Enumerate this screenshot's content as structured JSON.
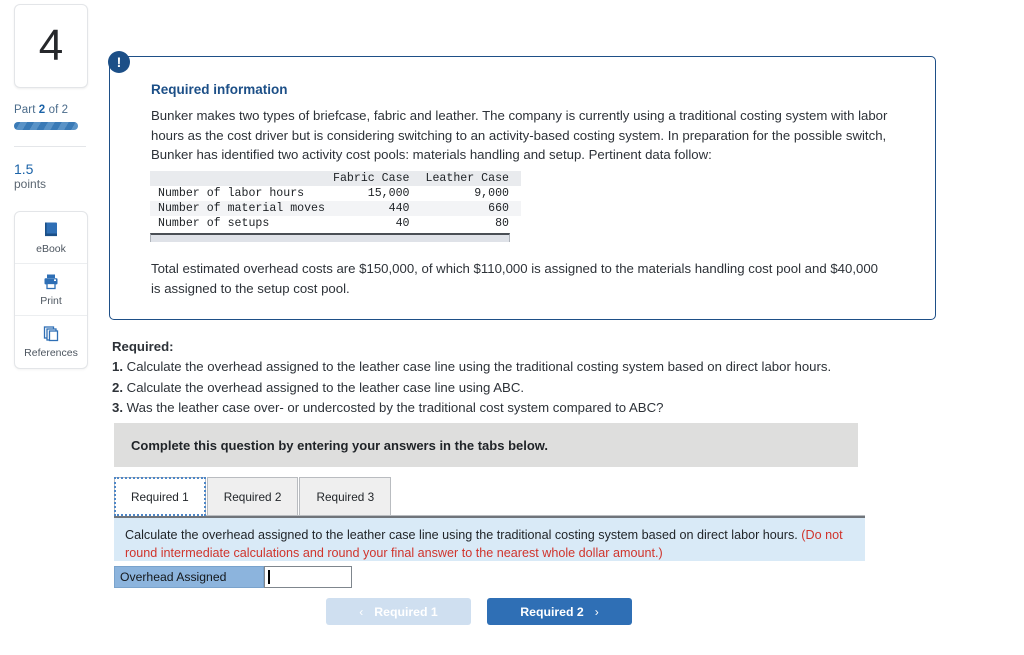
{
  "sidebar": {
    "question_number": "4",
    "part_label_prefix": "Part ",
    "part_current": "2",
    "part_suffix": " of 2",
    "points_value": "1.5",
    "points_label": "points",
    "tools": [
      {
        "label": "eBook",
        "icon": "ebook-icon"
      },
      {
        "label": "Print",
        "icon": "printer-icon"
      },
      {
        "label": "References",
        "icon": "references-icon"
      }
    ]
  },
  "required_information": {
    "badge": "!",
    "title": "Required information",
    "paragraph": "Bunker makes two types of briefcase, fabric and leather. The company is currently using a traditional costing system with labor hours as the cost driver but is considering switching to an activity-based costing system. In preparation for the possible switch, Bunker has identified two activity cost pools: materials handling and setup. Pertinent data follow:",
    "closing_paragraph": "Total estimated overhead costs are $150,000, of which $110,000 is assigned to the materials handling cost pool and $40,000 is assigned to the setup cost pool.",
    "table": {
      "headers": [
        "",
        "Fabric Case",
        "Leather Case"
      ],
      "rows": [
        {
          "name": "Number of labor hours",
          "fabric": "15,000",
          "leather": "9,000"
        },
        {
          "name": "Number of material moves",
          "fabric": "440",
          "leather": "660"
        },
        {
          "name": "Number of setups",
          "fabric": "40",
          "leather": "80"
        }
      ]
    }
  },
  "required_section": {
    "heading": "Required:",
    "items": [
      {
        "num": "1.",
        "text": " Calculate the overhead assigned to the leather case line using the traditional costing system based on direct labor hours."
      },
      {
        "num": "2.",
        "text": " Calculate the overhead assigned to the leather case line using ABC."
      },
      {
        "num": "3.",
        "text": " Was the leather case over- or undercosted by the traditional cost system compared to ABC?"
      }
    ]
  },
  "answer_widget": {
    "header": "Complete this question by entering your answers in the tabs below.",
    "tabs": [
      {
        "label": "Required 1",
        "active": true
      },
      {
        "label": "Required 2",
        "active": false
      },
      {
        "label": "Required 3",
        "active": false
      }
    ],
    "panel_instruction": "Calculate the overhead assigned to the leather case line using the traditional costing system based on direct labor hours. ",
    "panel_hint": "(Do not round intermediate calculations and round your final answer to the nearest whole dollar amount.)",
    "answer_label": "Overhead Assigned",
    "answer_value": "",
    "answer_placeholder": ""
  },
  "navigation": {
    "prev_label": "Required 1",
    "next_label": "Required 2",
    "prev_chevron": "‹",
    "next_chevron": "›"
  },
  "colors": {
    "brand_blue": "#1c4f87",
    "link_blue": "#1b63a8",
    "button_blue": "#2f6fb5",
    "panel_blue": "#d9eaf7",
    "label_blue": "#8cb4dd",
    "hint_red": "#d0342c",
    "header_gray": "#dededd"
  }
}
